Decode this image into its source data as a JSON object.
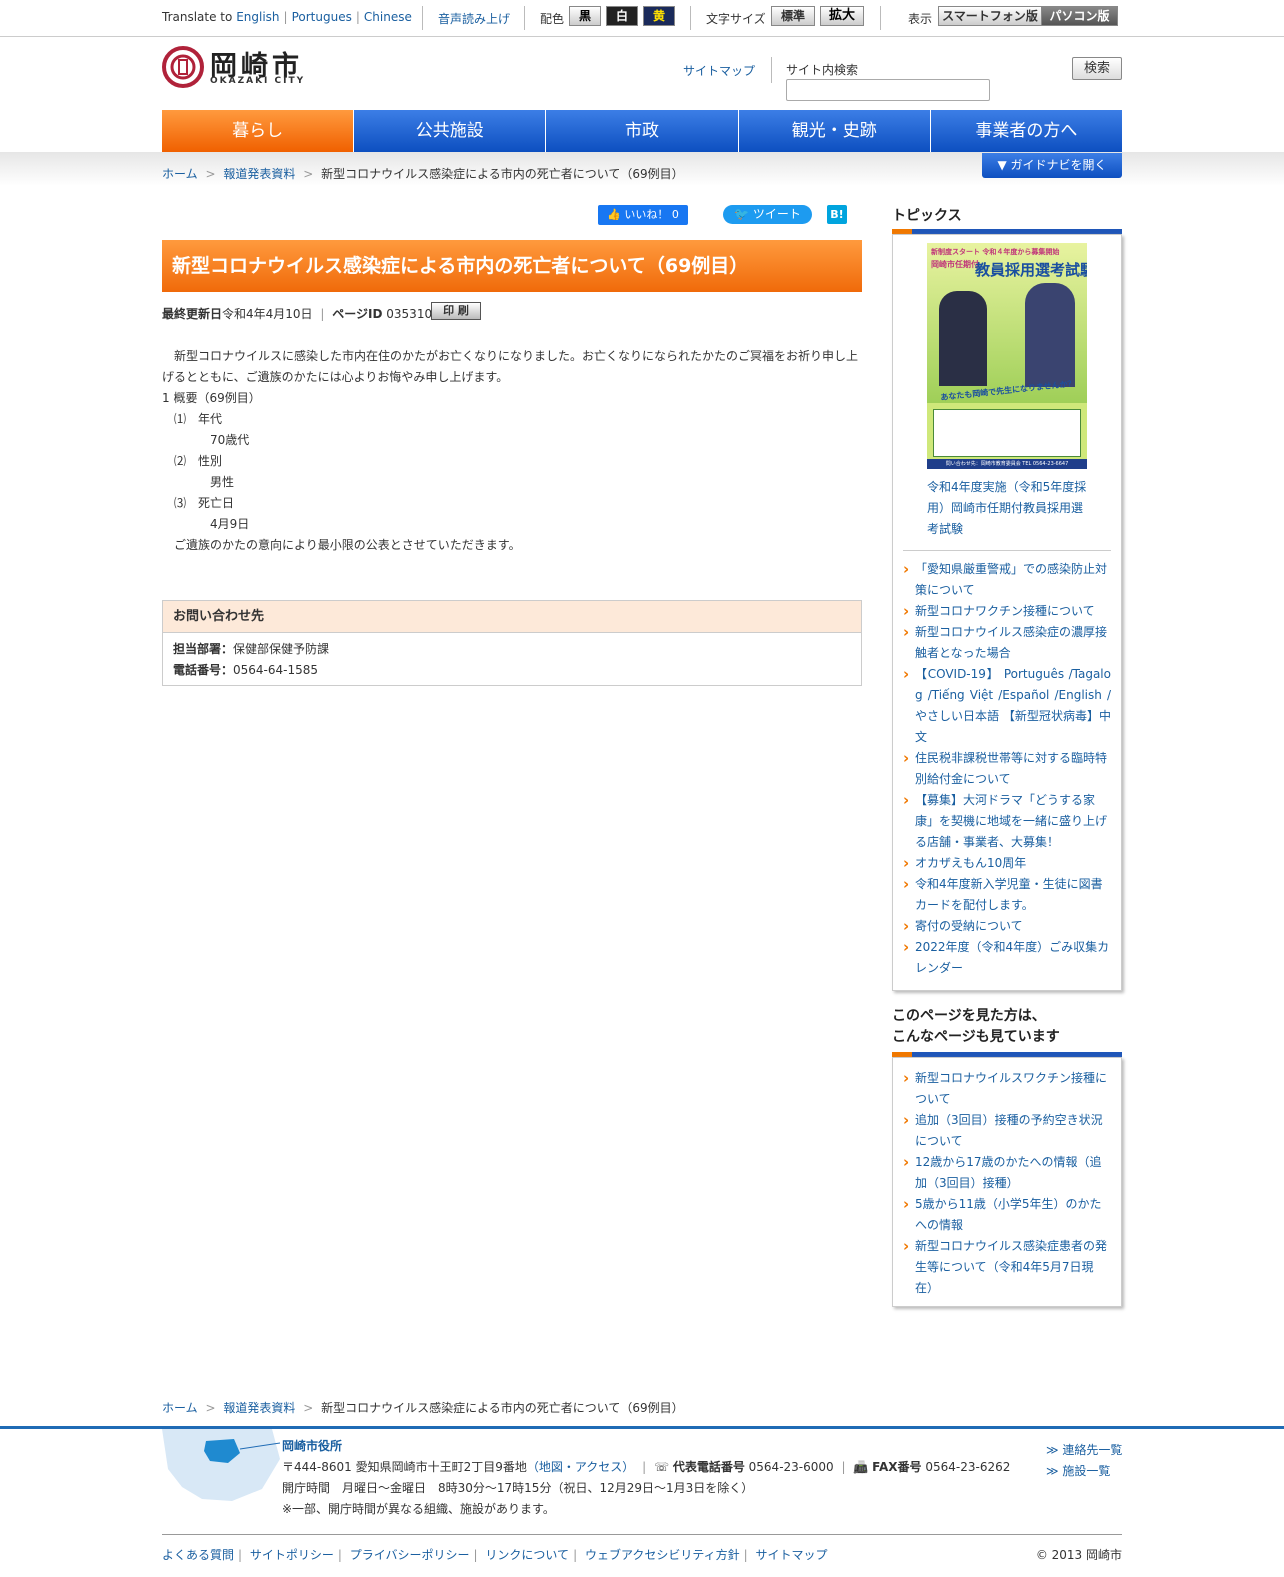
{
  "util": {
    "translate_label": "Translate to",
    "lang_en": "English",
    "lang_pt": "Portugues",
    "lang_zh": "Chinese",
    "voice": "音声読み上げ",
    "color_label": "配色",
    "color_black": "黒",
    "color_white": "白",
    "color_yellow": "黄",
    "font_label": "文字サイズ",
    "font_std": "標準",
    "font_big": "拡大",
    "display_label": "表示",
    "display_sp": "スマートフォン版",
    "display_pc": "パソコン版"
  },
  "header": {
    "logo_jp": "岡崎市",
    "logo_en": "OKAZAKI CITY",
    "sitemap": "サイトマップ",
    "search_label": "サイト内検索",
    "search_button": "検索",
    "search_value": ""
  },
  "nav": [
    "暮らし",
    "公共施設",
    "市政",
    "観光・史跡",
    "事業者の方へ"
  ],
  "guide_button": "▼ ガイドナビを開く",
  "breadcrumb": {
    "home": "ホーム",
    "section": "報道発表資料",
    "current": "新型コロナウイルス感染症による市内の死亡者について（69例目）",
    "sep": ">"
  },
  "social": {
    "like": "いいね！ 0",
    "tweet": "ツイート",
    "hatena": "B!"
  },
  "article": {
    "title": "新型コロナウイルス感染症による市内の死亡者について（69例目）",
    "updated_label": "最終更新日",
    "updated": "令和4年4月10日",
    "pageid_label": "ページID",
    "pageid": "035310",
    "print": "印 刷",
    "para": "　新型コロナウイルスに感染した市内在住のかたがお亡くなりになりました。お亡くなりになられたかたのご冥福をお祈り申し上げるとともに、ご遺族のかたには心よりお悔やみ申し上げます。",
    "outline": "1 概要（69例目）",
    "i1": "　⑴　年代",
    "v1": "　　　　70歳代",
    "i2": "　⑵　性別",
    "v2": "　　　　男性",
    "i3": "　⑶　死亡日",
    "v3": "　　　　4月9日",
    "closing": "　ご遺族のかたの意向により最小限の公表とさせていただきます。"
  },
  "contact": {
    "heading": "お問い合わせ先",
    "dept_label": "担当部署：",
    "dept": "保健部保健予防課",
    "tel_label": "電話番号：",
    "tel": "0564-64-1585"
  },
  "sidebar": {
    "topics_title": "トピックス",
    "banner": {
      "top": "新制度スタート 令和４年度から募集開始",
      "main": "教員採用選考試験",
      "sub": "岡崎市任期付",
      "cta": "あなたも岡崎で先生になりませんか？",
      "contact": "問い合わせ先：岡崎市教育委員会 TEL 0564-23-6647"
    },
    "banner_caption": "令和4年度実施（令和5年度採用）岡崎市任期付教員採用選考試験",
    "topics": [
      "「愛知県厳重警戒」での感染防止対策について",
      "新型コロナワクチン接種について",
      "新型コロナウイルス感染症の濃厚接触者となった場合",
      "【COVID-19】 Português /Tagalog /Tiếng Việt /Español /English /やさしい日本語 【新型冠状病毒】中文",
      "住民税非課税世帯等に対する臨時特別給付金について",
      "【募集】大河ドラマ「どうする家康」を契機に地域を一緒に盛り上げる店舗・事業者、大募集！",
      "オカザえもん10周年",
      "令和4年度新入学児童・生徒に図書カードを配付します。",
      "寄付の受納について",
      "2022年度（令和4年度）ごみ収集カレンダー"
    ],
    "related_title_1": "このページを見た方は、",
    "related_title_2": "こんなページも見ています",
    "related": [
      "新型コロナウイルスワクチン接種について",
      "追加（3回目）接種の予約空き状況について",
      "12歳から17歳のかたへの情報（追加（3回目）接種）",
      "5歳から11歳（小学5年生）のかたへの情報",
      "新型コロナウイルス感染症患者の発生等について（令和4年5月7日現在）"
    ]
  },
  "footer": {
    "org": "岡崎市役所",
    "address": "〒444-8601 愛知県岡崎市十王町2丁目9番地",
    "map_link": "（地図・アクセス）",
    "tel_label": "代表電話番号",
    "tel": "0564-23-6000",
    "fax_label": "FAX番号",
    "fax": "0564-23-6262",
    "hours": "開庁時間　月曜日～金曜日　8時30分～17時15分（祝日、12月29日～1月3日を除く）",
    "note": "※一部、開庁時間が異なる組織、施設があります。",
    "contacts_link": "≫ 連絡先一覧",
    "facilities_link": "≫ 施設一覧",
    "links": [
      "よくある質問",
      "サイトポリシー",
      "プライバシーポリシー",
      "リンクについて",
      "ウェブアクセシビリティ方針",
      "サイトマップ"
    ],
    "copyright": "© 2013 岡崎市"
  }
}
